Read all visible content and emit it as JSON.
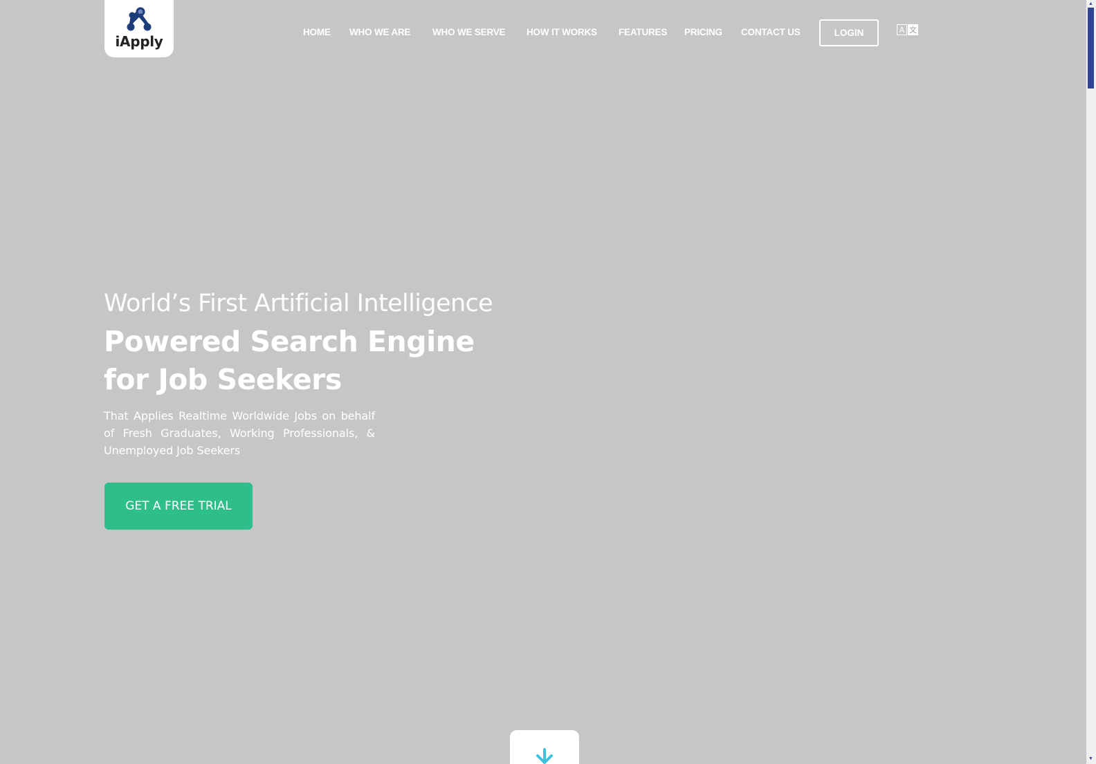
{
  "brand": {
    "name": "iApply",
    "logo_icon": "network-nodes-logo-icon",
    "logo_color": "#1c3d7a"
  },
  "nav": {
    "items": [
      {
        "label": "HOME"
      },
      {
        "label": "WHO WE ARE"
      },
      {
        "label": "WHO WE SERVE"
      },
      {
        "label": "HOW IT WORKS"
      },
      {
        "label": "FEATURES"
      },
      {
        "label": "PRICING"
      },
      {
        "label": "CONTACT US"
      }
    ],
    "login_label": "LOGIN",
    "language_icon": "translate-icon",
    "language_glyphs": [
      "A",
      "文"
    ]
  },
  "hero": {
    "line1": "World’s First Artificial Intelligence",
    "title_line2": "Powered Search Engine",
    "title_line3": "for Job Seekers",
    "subtitle": "That Applies Realtime Worldwide Jobs on behalf of Fresh Graduates, Working Professionals, & Unemployed Job Seekers",
    "cta_label": "GET A FREE TRIAL"
  },
  "scroll_down": {
    "icon": "arrow-down-icon"
  },
  "colors": {
    "background": "#c6c6c8",
    "cta": "#2dbe8a",
    "scroll_arrow": "#3fc2e0",
    "scrollbar_thumb": "#2f4592"
  }
}
